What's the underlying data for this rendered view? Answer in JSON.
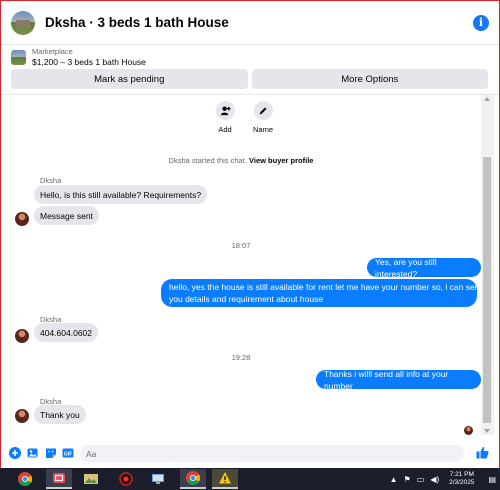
{
  "header": {
    "title": "Dksha · 3 beds 1 bath House"
  },
  "marketplace": {
    "label": "Marketplace",
    "listing": "$1,200 – 3 beds 1 bath House"
  },
  "actions": {
    "mark_pending": "Mark as pending",
    "more_options": "More Options"
  },
  "quick_actions": {
    "add_label": "Add",
    "name_label": "Name"
  },
  "system": {
    "started": "Dksha started this chat.",
    "view_profile": "View buyer profile"
  },
  "messages": {
    "sender_1": "Dksha",
    "m1": "Hello, is this still available? Requirements?",
    "m2": "Message sent",
    "time_1": "18:07",
    "m3": "Yes, are you still interested?",
    "m4_line1": "hello, yes the house is still available for rent  let me have your number so, i can send",
    "m4_line2": "you details and requirement about house",
    "sender_2": "Dksha",
    "m5": "404.604.0602",
    "time_2": "19:28",
    "m6": "Thanks i willl send all info at your number",
    "sender_3": "Dksha",
    "m7": "Thank you"
  },
  "composer": {
    "placeholder": "Aa"
  },
  "taskbar": {
    "apps": [
      "chrome-icon",
      "snip-icon",
      "photos-icon",
      "record-icon",
      "network-app-icon",
      "chrome-icon",
      "warning-icon"
    ],
    "time": "7:21 PM",
    "date": "2/3/2025"
  },
  "colors": {
    "accent": "#0a7cff",
    "bubble_in": "#e4e6eb",
    "taskbar": "#1c1f2b"
  }
}
